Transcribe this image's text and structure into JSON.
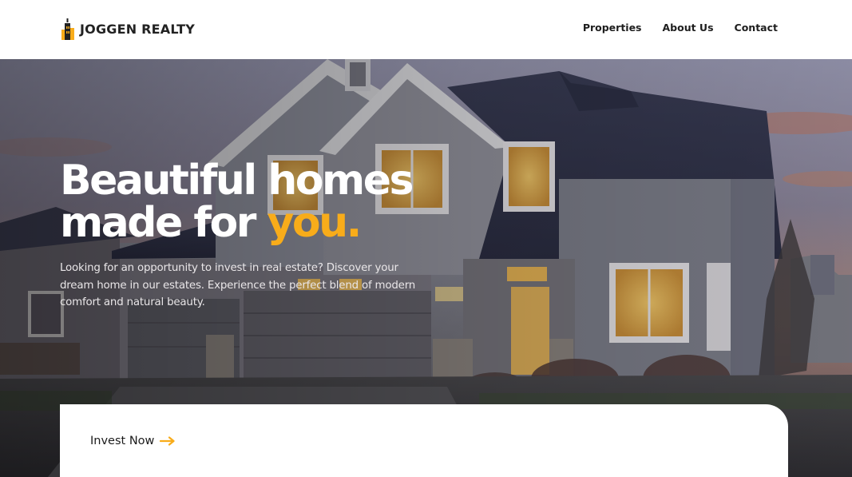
{
  "brand": {
    "name": "JOGGEN REALTY",
    "accent_color": "#f8ac1a"
  },
  "nav": {
    "items": [
      {
        "label": "Properties"
      },
      {
        "label": "About Us"
      },
      {
        "label": "Contact"
      }
    ]
  },
  "hero": {
    "title_line1": "Beautiful homes",
    "title_line2_prefix": "made for ",
    "title_line2_accent": "you.",
    "description": "Looking for an opportunity to invest in real estate? Discover your dream home in our estates. Experience the perfect blend of modern comfort and natural beauty.",
    "background": "two-story house at dusk with warm lit windows"
  },
  "cta": {
    "label": "Invest Now",
    "icon": "arrow-right-icon"
  },
  "icons": {
    "logo": "building-logo-icon"
  }
}
